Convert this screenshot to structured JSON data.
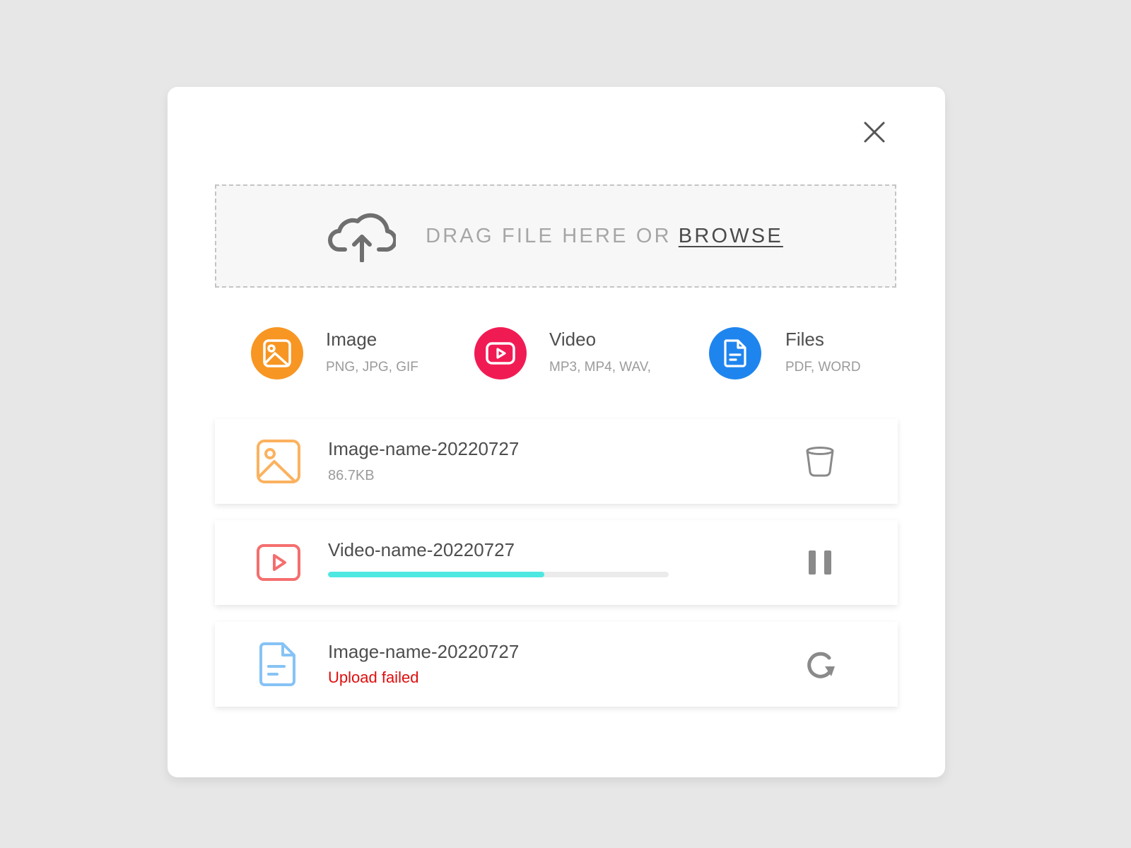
{
  "dropzone": {
    "text": "DRAG FILE HERE OR",
    "browse_label": "BROWSE",
    "icon": "cloud-upload-icon"
  },
  "types": [
    {
      "title": "Image",
      "formats": "PNG, JPG, GIF",
      "color": "#f79623",
      "icon": "image-icon"
    },
    {
      "title": "Video",
      "formats": "MP3, MP4, WAV,",
      "color": "#f11b54",
      "icon": "video-play-icon"
    },
    {
      "title": "Files",
      "formats": "PDF, WORD",
      "color": "#1f85ee",
      "icon": "document-icon"
    }
  ],
  "uploads": [
    {
      "name": "Image-name-20220727",
      "size": "86.7KB",
      "icon": "image-icon",
      "action_icon": "trash-icon"
    },
    {
      "name": "Video-name-20220727",
      "progress": 0.635,
      "icon": "video-play-icon",
      "action_icon": "pause-icon"
    },
    {
      "name": "Image-name-20220727",
      "status": "Upload failed",
      "icon": "document-icon",
      "action_icon": "retry-icon"
    }
  ],
  "colors": {
    "progress": "#4ee8e2",
    "error": "#e00d0d",
    "image_outline": "#fbb25f",
    "video_outline": "#f56e6e",
    "file_outline": "#86c3f5"
  }
}
